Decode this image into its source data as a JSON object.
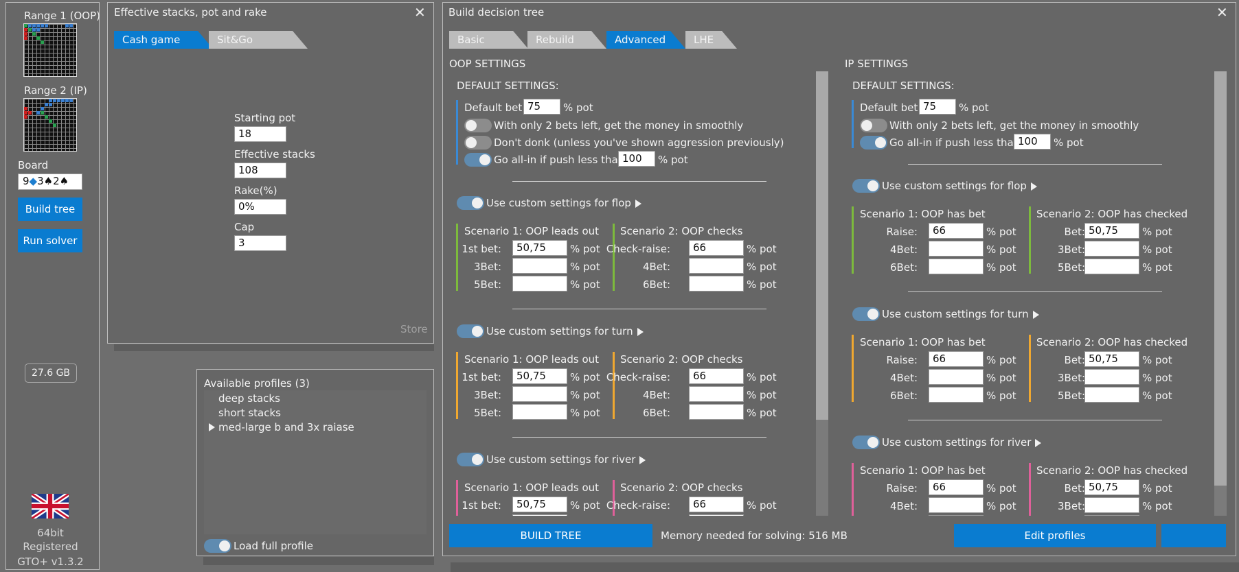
{
  "left_panel": {
    "range1_label": "Range 1 (OOP)",
    "range2_label": "Range 2 (IP)",
    "board_label": "Board",
    "board_cards": [
      {
        "rank": "9",
        "suit": "◆",
        "suit_color": "#1e7fd0"
      },
      {
        "rank": "3",
        "suit": "♠",
        "suit_color": "#111111"
      },
      {
        "rank": "2",
        "suit": "♠",
        "suit_color": "#111111"
      }
    ],
    "build_tree_label": "Build tree",
    "run_solver_label": "Run solver",
    "memory_badge": "27.6 GB",
    "bitness": "64bit",
    "registered": "Registered",
    "version": "GTO+ v1.3.2"
  },
  "stacks_window": {
    "title": "Effective stacks, pot and rake",
    "tabs": [
      {
        "label": "Cash game",
        "active": true
      },
      {
        "label": "Sit&Go",
        "active": false
      }
    ],
    "fields": [
      {
        "label": "Starting pot",
        "value": "18"
      },
      {
        "label": "Effective stacks",
        "value": "108"
      },
      {
        "label": "Rake(%)",
        "value": "0%"
      },
      {
        "label": "Cap",
        "value": "3"
      }
    ],
    "store_label": "Store"
  },
  "profiles_window": {
    "title": "Available profiles (3)",
    "items": [
      {
        "label": "deep stacks",
        "selected": false
      },
      {
        "label": "short stacks",
        "selected": false
      },
      {
        "label": "med-large b and 3x raiase",
        "selected": true
      }
    ],
    "load_full_label": "Load full profile"
  },
  "tree_window": {
    "title": "Build decision tree",
    "tabs": [
      {
        "label": "Basic",
        "active": false
      },
      {
        "label": "Rebuild",
        "active": false
      },
      {
        "label": "Advanced",
        "active": true
      },
      {
        "label": "LHE",
        "active": false
      }
    ],
    "pot_unit": "% pot",
    "oop": {
      "header": "OOP SETTINGS",
      "default_title": "DEFAULT SETTINGS:",
      "default_bet_label": "Default bet:",
      "default_bet": "75",
      "smooth_label": "With only 2 bets left, get the money in smoothly",
      "smooth_on": false,
      "donk_label": "Don't donk (unless you've shown aggression previously)",
      "donk_on": false,
      "allin_label": "Go all-in if push less than",
      "allin_on": true,
      "allin_value": "100",
      "streets": [
        {
          "label": "Use custom settings for flop",
          "on": true,
          "color": "#7dbb3c",
          "s1_title": "Scenario 1: OOP leads out",
          "s1_rows": [
            {
              "label": "1st bet:",
              "value": "50,75"
            },
            {
              "label": "3Bet:",
              "value": ""
            },
            {
              "label": "5Bet:",
              "value": ""
            }
          ],
          "s2_title": "Scenario 2: OOP checks",
          "s2_rows": [
            {
              "label": "Check-raise:",
              "value": "66"
            },
            {
              "label": "4Bet:",
              "value": ""
            },
            {
              "label": "6Bet:",
              "value": ""
            }
          ]
        },
        {
          "label": "Use custom settings for turn",
          "on": true,
          "color": "#f0a830",
          "s1_title": "Scenario 1: OOP leads out",
          "s1_rows": [
            {
              "label": "1st bet:",
              "value": "50,75"
            },
            {
              "label": "3Bet:",
              "value": ""
            },
            {
              "label": "5Bet:",
              "value": ""
            }
          ],
          "s2_title": "Scenario 2: OOP checks",
          "s2_rows": [
            {
              "label": "Check-raise:",
              "value": "66"
            },
            {
              "label": "4Bet:",
              "value": ""
            },
            {
              "label": "6Bet:",
              "value": ""
            }
          ]
        },
        {
          "label": "Use custom settings for river",
          "on": true,
          "color": "#e0609a",
          "s1_title": "Scenario 1: OOP leads out",
          "s1_rows": [
            {
              "label": "1st bet:",
              "value": "50,75"
            }
          ],
          "s2_title": "Scenario 2: OOP checks",
          "s2_rows": [
            {
              "label": "Check-raise:",
              "value": "66"
            }
          ]
        }
      ]
    },
    "ip": {
      "header": "IP SETTINGS",
      "default_title": "DEFAULT SETTINGS:",
      "default_bet_label": "Default bet:",
      "default_bet": "75",
      "smooth_label": "With only 2 bets left, get the money in smoothly",
      "smooth_on": false,
      "allin_label": "Go all-in if push less than",
      "allin_on": true,
      "allin_value": "100",
      "streets": [
        {
          "label": "Use custom settings for flop",
          "on": true,
          "color": "#7dbb3c",
          "s1_title": "Scenario 1: OOP has bet",
          "s1_rows": [
            {
              "label": "Raise:",
              "value": "66"
            },
            {
              "label": "4Bet:",
              "value": ""
            },
            {
              "label": "6Bet:",
              "value": ""
            }
          ],
          "s2_title": "Scenario 2: OOP has checked",
          "s2_rows": [
            {
              "label": "Bet:",
              "value": "50,75"
            },
            {
              "label": "3Bet:",
              "value": ""
            },
            {
              "label": "5Bet:",
              "value": ""
            }
          ]
        },
        {
          "label": "Use custom settings for turn",
          "on": true,
          "color": "#f0a830",
          "s1_title": "Scenario 1: OOP has bet",
          "s1_rows": [
            {
              "label": "Raise:",
              "value": "66"
            },
            {
              "label": "4Bet:",
              "value": ""
            },
            {
              "label": "6Bet:",
              "value": ""
            }
          ],
          "s2_title": "Scenario 2: OOP has checked",
          "s2_rows": [
            {
              "label": "Bet:",
              "value": "50,75"
            },
            {
              "label": "3Bet:",
              "value": ""
            },
            {
              "label": "5Bet:",
              "value": ""
            }
          ]
        },
        {
          "label": "Use custom settings for river",
          "on": true,
          "color": "#e0609a",
          "s1_title": "Scenario 1: OOP has bet",
          "s1_rows": [
            {
              "label": "Raise:",
              "value": "66"
            },
            {
              "label": "4Bet:",
              "value": ""
            }
          ],
          "s2_title": "Scenario 2: OOP has checked",
          "s2_rows": [
            {
              "label": "Bet:",
              "value": "50,75"
            },
            {
              "label": "3Bet:",
              "value": ""
            }
          ]
        }
      ]
    },
    "build_tree_button": "BUILD TREE",
    "memory_label": "Memory needed for solving: 516 MB",
    "edit_profiles_button": "Edit profiles",
    "extra_button": ""
  },
  "colors": {
    "accent": "#0a7cd0",
    "flop": "#7dbb3c",
    "turn": "#f0a830",
    "river": "#e0609a"
  }
}
